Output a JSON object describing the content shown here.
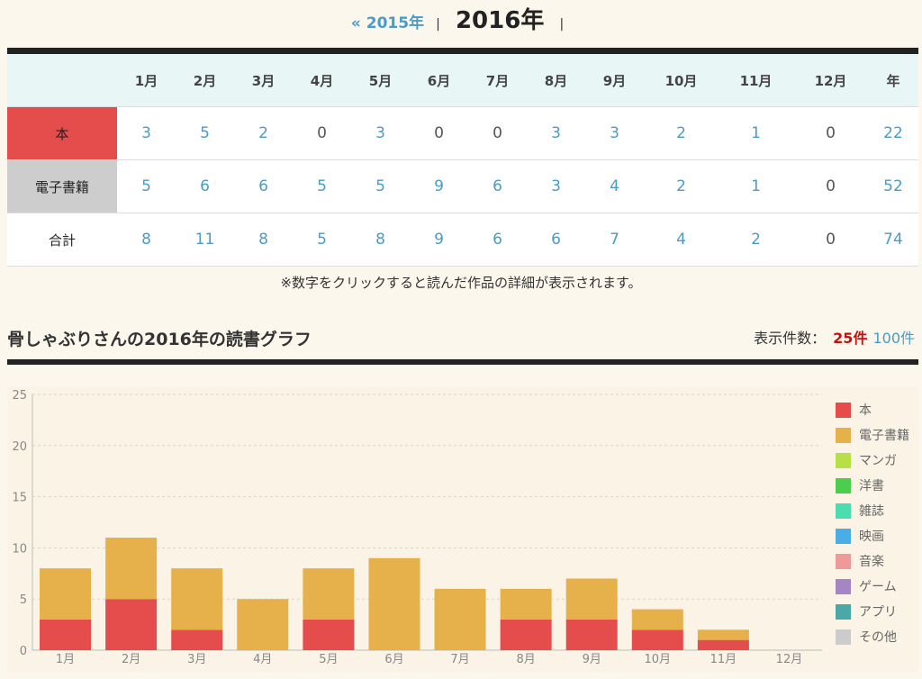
{
  "yearnav": {
    "prev": "« 2015年",
    "current": "2016年",
    "sep": "|"
  },
  "table": {
    "headers": [
      "",
      "1月",
      "2月",
      "3月",
      "4月",
      "5月",
      "6月",
      "7月",
      "8月",
      "9月",
      "10月",
      "11月",
      "12月",
      "年"
    ],
    "rows": [
      {
        "label": "本",
        "values": [
          "3",
          "5",
          "2",
          "0",
          "3",
          "0",
          "0",
          "3",
          "3",
          "2",
          "1",
          "0",
          "22"
        ]
      },
      {
        "label": "電子書籍",
        "values": [
          "5",
          "6",
          "6",
          "5",
          "5",
          "9",
          "6",
          "3",
          "4",
          "2",
          "1",
          "0",
          "52"
        ]
      },
      {
        "label": "合計",
        "values": [
          "8",
          "11",
          "8",
          "5",
          "8",
          "9",
          "6",
          "6",
          "7",
          "4",
          "2",
          "0",
          "74"
        ]
      }
    ]
  },
  "note": "※数字をクリックすると読んだ作品の詳細が表示されます。",
  "graph": {
    "title": "骨しゃぶりさんの2016年の読書グラフ",
    "count_label": "表示件数：",
    "count_selected": "25件",
    "count_other": "100件"
  },
  "colors": {
    "book": "#e54d4d",
    "ebook": "#e6b14a",
    "link": "#4a9bc7",
    "selected_count": "#c51010"
  },
  "chart_data": {
    "type": "bar",
    "stacked": true,
    "categories": [
      "1月",
      "2月",
      "3月",
      "4月",
      "5月",
      "6月",
      "7月",
      "8月",
      "9月",
      "10月",
      "11月",
      "12月"
    ],
    "series": [
      {
        "name": "本",
        "color": "#e54d4d",
        "values": [
          3,
          5,
          2,
          0,
          3,
          0,
          0,
          3,
          3,
          2,
          1,
          0
        ]
      },
      {
        "name": "電子書籍",
        "color": "#e6b14a",
        "values": [
          5,
          6,
          6,
          5,
          5,
          9,
          6,
          3,
          4,
          2,
          1,
          0
        ]
      }
    ],
    "yticks": [
      0,
      5,
      10,
      15,
      20,
      25
    ],
    "ylim": [
      0,
      25
    ],
    "grid": true,
    "legend_position": "right",
    "legend": [
      {
        "name": "本",
        "color": "#e54d4d"
      },
      {
        "name": "電子書籍",
        "color": "#e6b14a"
      },
      {
        "name": "マンガ",
        "color": "#b5e048"
      },
      {
        "name": "洋書",
        "color": "#4ccd4c"
      },
      {
        "name": "雑誌",
        "color": "#4ddbb0"
      },
      {
        "name": "映画",
        "color": "#4aaee5"
      },
      {
        "name": "音楽",
        "color": "#ee9a9a"
      },
      {
        "name": "ゲーム",
        "color": "#a585c4"
      },
      {
        "name": "アプリ",
        "color": "#4aa8a8"
      },
      {
        "name": "その他",
        "color": "#cccccc"
      }
    ]
  }
}
